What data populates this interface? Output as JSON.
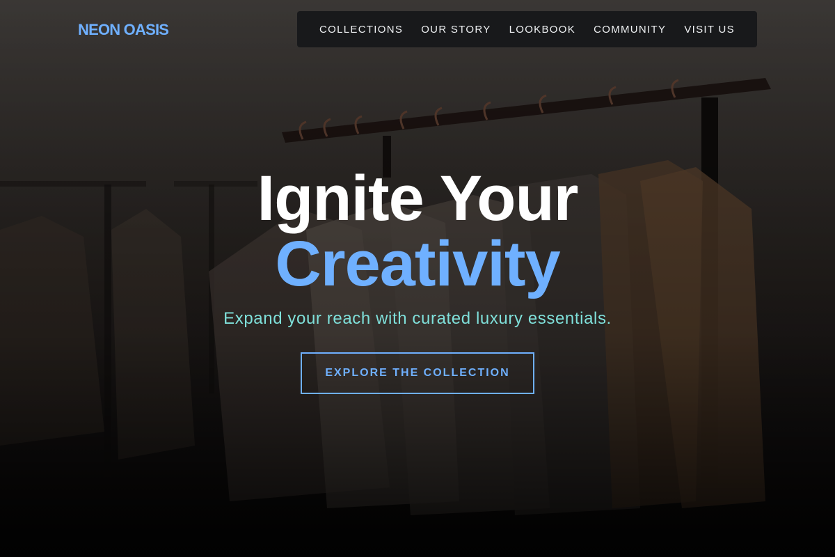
{
  "brand": {
    "name": "NEON OASIS",
    "accent_color": "#6fb0ff"
  },
  "nav": {
    "items": [
      {
        "label": "COLLECTIONS"
      },
      {
        "label": "OUR STORY"
      },
      {
        "label": "LOOKBOOK"
      },
      {
        "label": "COMMUNITY"
      },
      {
        "label": "VISIT US"
      }
    ]
  },
  "hero": {
    "title_line1": "Ignite Your",
    "title_line2": "Creativity",
    "subtitle": "Expand your reach with curated luxury essentials.",
    "cta_label": "EXPLORE THE COLLECTION",
    "background_image": "clothing-rack-photo",
    "subtitle_color": "#7fe0da"
  }
}
